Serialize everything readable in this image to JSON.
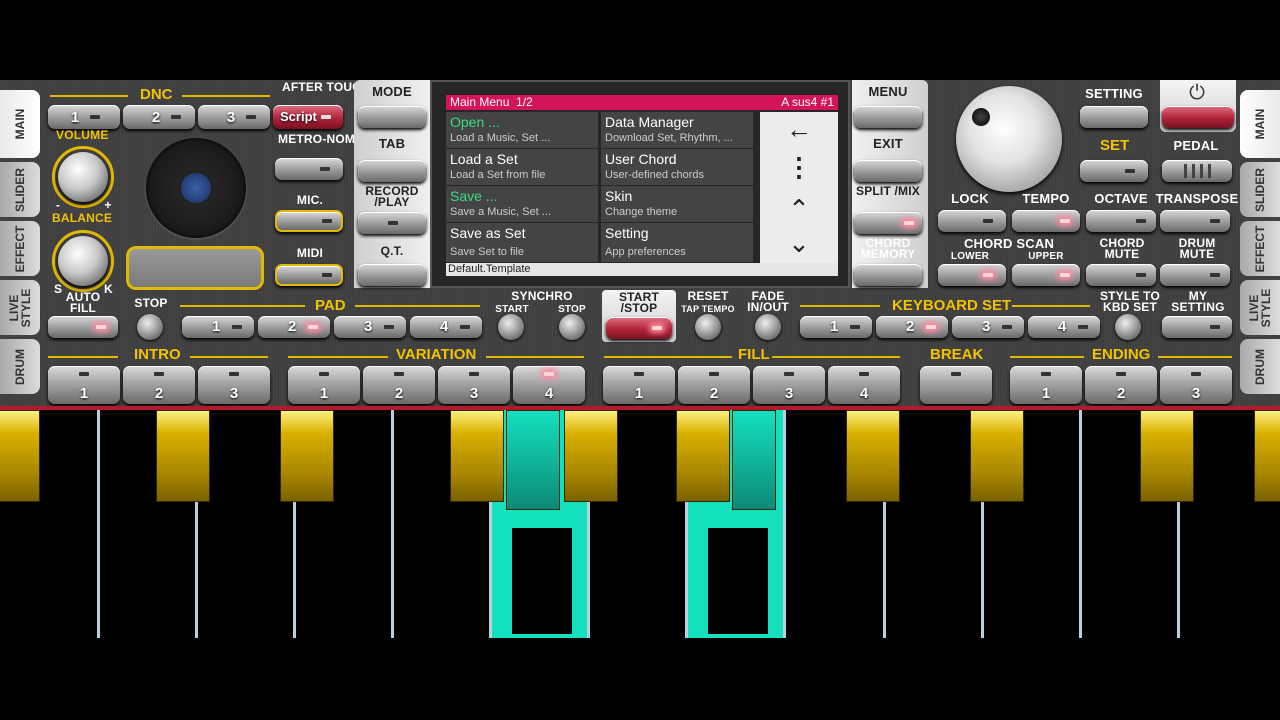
{
  "side_tabs_left": [
    "MAIN",
    "SLIDER",
    "EFFECT",
    "LIVE STYLE",
    "DRUM"
  ],
  "side_tabs_right": [
    "MAIN",
    "SLIDER",
    "EFFECT",
    "LIVE STYLE",
    "DRUM"
  ],
  "dnc": {
    "label": "DNC",
    "buttons": [
      "1",
      "2",
      "3"
    ]
  },
  "after_touch": {
    "label": "AFTER TOUCH",
    "button": "Script"
  },
  "volume_label": "VOLUME",
  "balance_label": "BALANCE",
  "knob_marks": {
    "minus": "-",
    "plus": "+",
    "s": "S",
    "k": "K"
  },
  "metronome_label": "METRO-NOME",
  "mic_label": "MIC.",
  "midi_label": "MIDI",
  "center_buttons": [
    "MODE",
    "TAB",
    "RECORD /PLAY",
    "Q.T."
  ],
  "right_buttons": [
    "MENU",
    "EXIT",
    "SPLIT /MIX",
    "CHORD MEMORY"
  ],
  "menu": {
    "title": "Main Menu",
    "page": "1/2",
    "chord": "A sus4 #1",
    "items": [
      {
        "title": "Open ...",
        "sub": "Load a Music, Set ..."
      },
      {
        "title": "Data Manager",
        "sub": "Download Set, Rhythm, ..."
      },
      {
        "title": "Load a Set",
        "sub": "Load a Set from file"
      },
      {
        "title": "User Chord",
        "sub": "User-defined chords"
      },
      {
        "title": "Save ...",
        "sub": "Save a Music, Set ..."
      },
      {
        "title": "Skin",
        "sub": "Change theme"
      },
      {
        "title": "Save as Set",
        "sub": "Save Set to file"
      },
      {
        "title": "Setting",
        "sub": "App preferences"
      }
    ],
    "footer": "Default.Template",
    "nav": {
      "back": "←",
      "more": "⋮",
      "up": "⌃",
      "down": "⌄"
    }
  },
  "setting_label": "SETTING",
  "set_label": "SET",
  "pedal_label": "PEDAL",
  "power_icon": "power-icon",
  "lock_label": "LOCK",
  "tempo_label": "TEMPO",
  "octave_label": "OCTAVE",
  "transpose_label": "TRANSPOSE",
  "chord_scan": {
    "label": "CHORD SCAN",
    "lower": "LOWER",
    "upper": "UPPER"
  },
  "chord_mute_label": "CHORD MUTE",
  "drum_mute_label": "DRUM MUTE",
  "auto_fill_label": "AUTO FILL",
  "stop_label": "STOP",
  "pad": {
    "label": "PAD",
    "buttons": [
      "1",
      "2",
      "3",
      "4"
    ]
  },
  "synchro": {
    "label": "SYNCHRO",
    "start": "START",
    "stop": "STOP"
  },
  "start_stop_label": "START /STOP",
  "reset": {
    "label": "RESET",
    "sub": "TAP TEMPO"
  },
  "fade_label": "FADE IN/OUT",
  "keyboard_set": {
    "label": "KEYBOARD SET",
    "buttons": [
      "1",
      "2",
      "3",
      "4"
    ]
  },
  "style_to_kbd_label": "STYLE TO KBD SET",
  "my_setting_label": "MY SETTING",
  "intro": {
    "label": "INTRO",
    "buttons": [
      "1",
      "2",
      "3"
    ]
  },
  "variation": {
    "label": "VARIATION",
    "buttons": [
      "1",
      "2",
      "3",
      "4"
    ]
  },
  "fill": {
    "label": "FILL",
    "buttons": [
      "1",
      "2",
      "3",
      "4"
    ]
  },
  "break_label": "BREAK",
  "ending": {
    "label": "ENDING",
    "buttons": [
      "1",
      "2",
      "3"
    ]
  },
  "colors": {
    "accent_yellow": "#f2c300",
    "pressed_key": "#14e0c0",
    "menu_header": "#d4145a",
    "start_red": "#b0243a"
  }
}
